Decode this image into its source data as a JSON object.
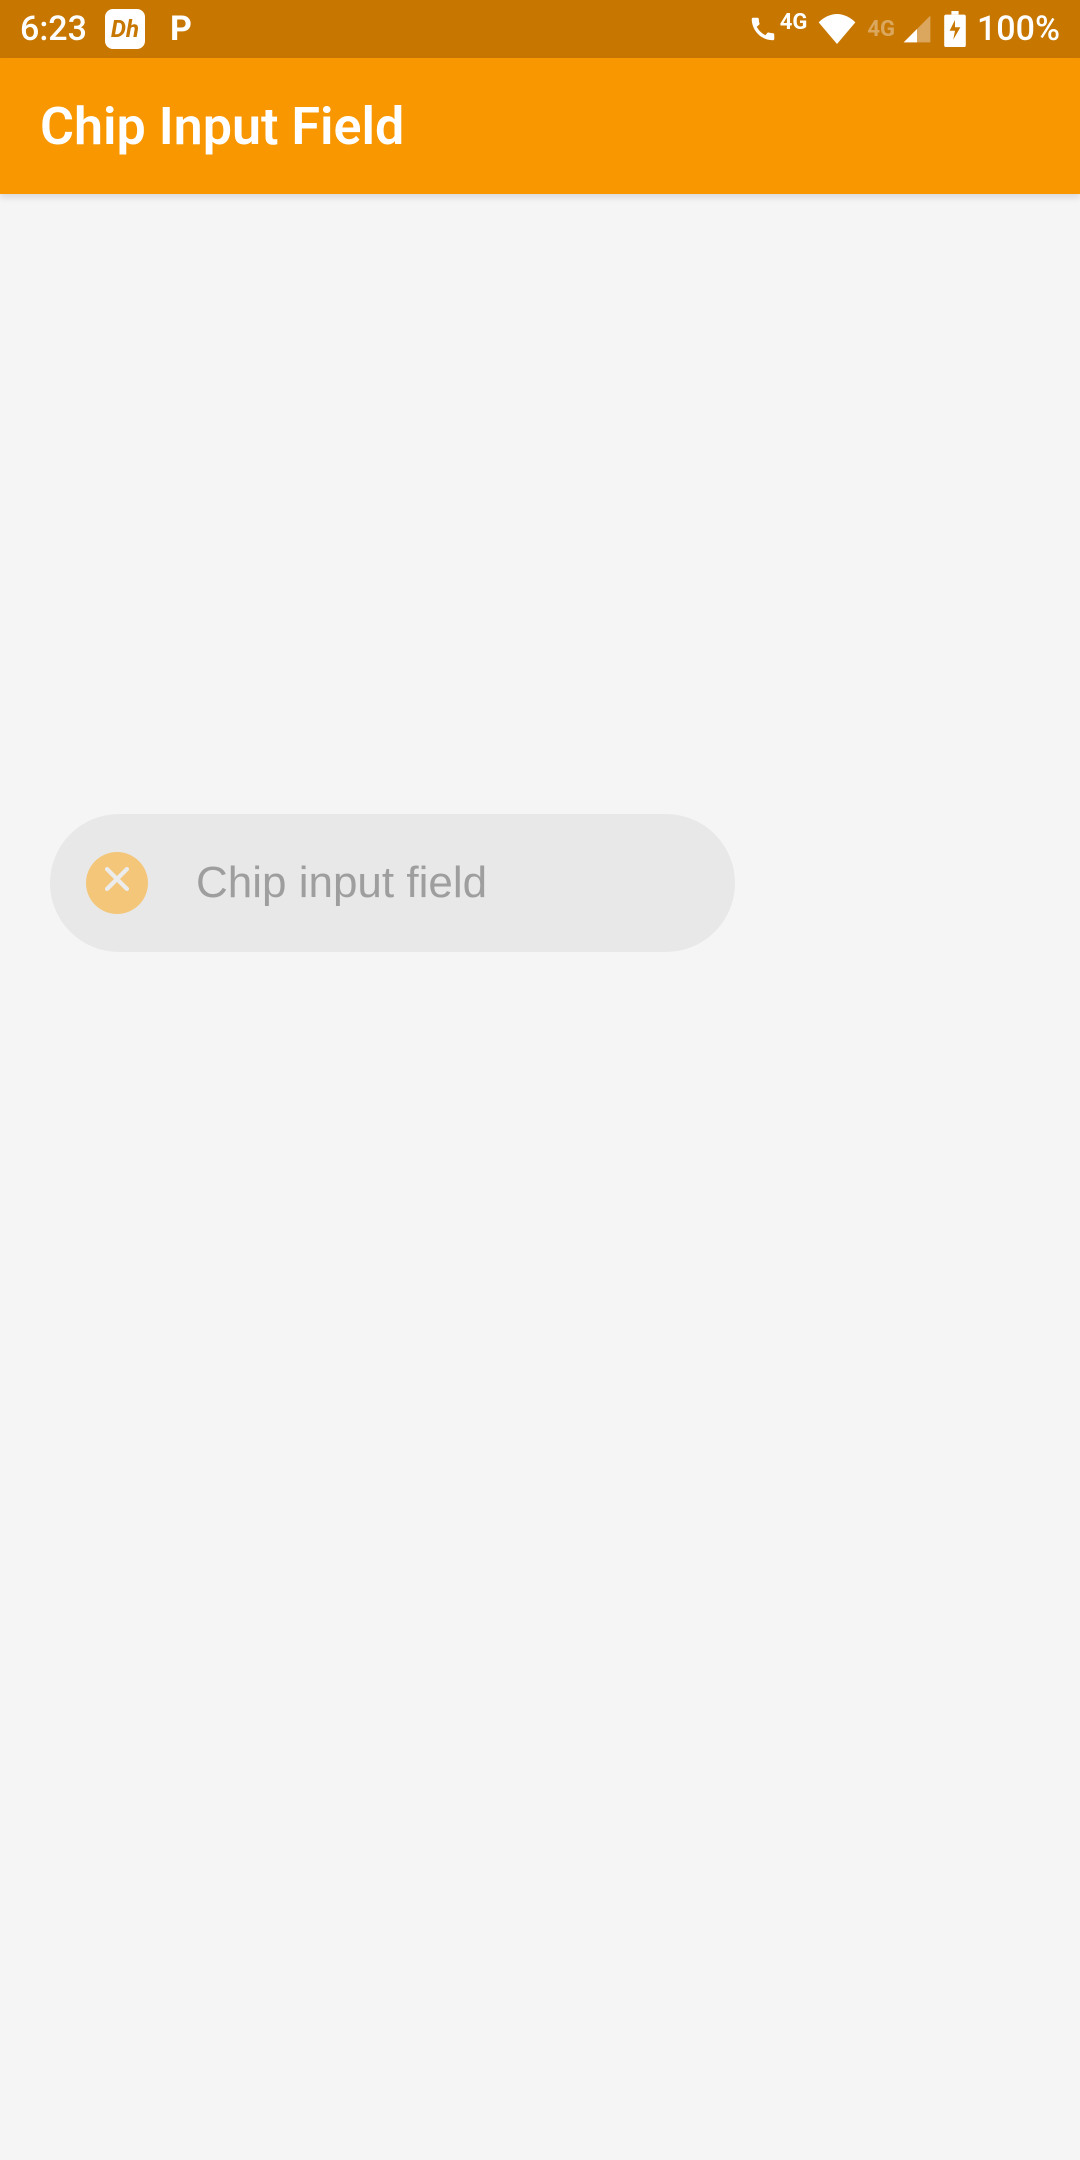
{
  "statusbar": {
    "time": "6:23",
    "app_icon_1": "Dh",
    "app_icon_2": "P",
    "network_label": "4G",
    "network_label_faded": "4G",
    "battery": "100%"
  },
  "appbar": {
    "title": "Chip Input Field"
  },
  "input": {
    "placeholder": "Chip input field",
    "value": ""
  }
}
